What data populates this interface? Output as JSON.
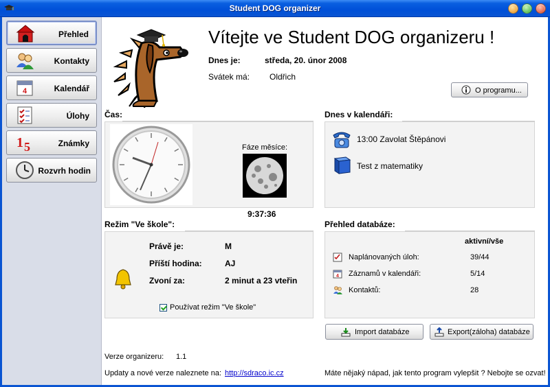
{
  "window": {
    "title": "Student DOG organizer"
  },
  "sidebar": {
    "items": [
      {
        "label": "Přehled",
        "icon": "doghouse-icon",
        "active": true
      },
      {
        "label": "Kontakty",
        "icon": "contacts-icon"
      },
      {
        "label": "Kalendář",
        "icon": "calendar-icon"
      },
      {
        "label": "Úlohy",
        "icon": "tasks-icon"
      },
      {
        "label": "Známky",
        "icon": "grades-icon"
      },
      {
        "label": "Rozvrh hodin",
        "icon": "clock-icon"
      }
    ]
  },
  "header": {
    "welcome": "Vítejte ve Student DOG organizeru !",
    "today_label": "Dnes je:",
    "today_value": "středa, 20. únor 2008",
    "nameday_label": "Svátek má:",
    "nameday_value": "Oldřich",
    "about_button": "O programu..."
  },
  "time_section": {
    "title": "Čas:",
    "moon_label": "Fáze měsíce:",
    "clock_time": "9:37:36"
  },
  "calendar_section": {
    "title": "Dnes v kalendáři:",
    "events": [
      {
        "text": "13:00 Zavolat Štěpánovi",
        "icon": "telephone-icon"
      },
      {
        "text": "Test z matematiky",
        "icon": "book-icon"
      }
    ]
  },
  "school_section": {
    "title": "Režim \"Ve škole\":",
    "now_label": "Právě je:",
    "now_value": "M",
    "next_label": "Příští hodina:",
    "next_value": "AJ",
    "ring_label": "Zvoní za:",
    "ring_value": "2 minut a 23 vteřin",
    "checkbox_label": "Používat režim \"Ve škole\"",
    "checkbox_checked": true
  },
  "db_section": {
    "title": "Přehled databáze:",
    "column_header": "aktivní/vše",
    "rows": [
      {
        "label": "Naplánovaných úloh:",
        "value": "39/44"
      },
      {
        "label": "Záznamů v kalendáři:",
        "value": "5/14"
      },
      {
        "label": "Kontaktů:",
        "value": "28"
      }
    ],
    "import_button": "Import databáze",
    "export_button": "Export(záloha) databáze"
  },
  "footer": {
    "version_label": "Verze organizeru:",
    "version_value": "1.1",
    "updates_text": "Updaty a nové verze naleznete na:",
    "updates_link": "http://sdraco.ic.cz",
    "idea_text": "Máte nějaký nápad, jak tento program vylepšit ? Nebojte se ozvat!"
  },
  "colors": {
    "titlebar": "#0a54d2",
    "sidebar": "#d9dde8",
    "link": "#0000cc"
  }
}
